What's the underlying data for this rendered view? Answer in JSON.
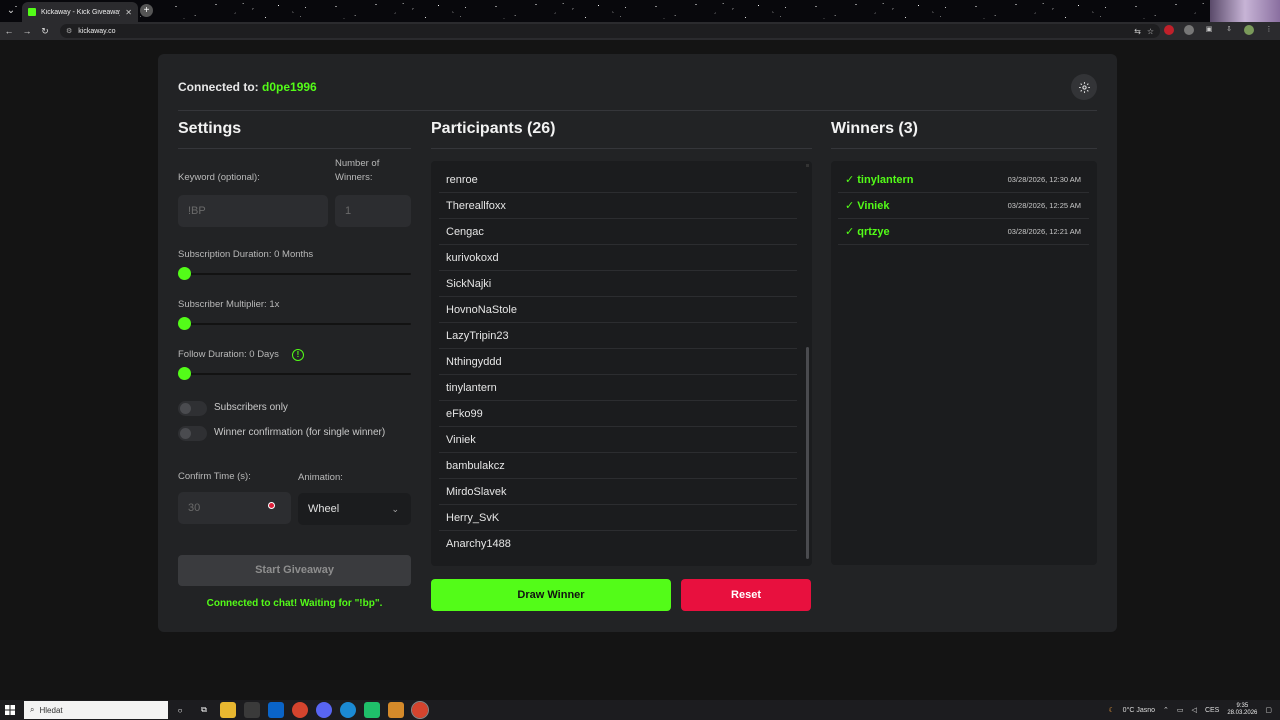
{
  "browser": {
    "tab_title": "Kickaway - Kick Giveaway Tool",
    "url": "kickaway.co"
  },
  "header": {
    "connected_label": "Connected to:",
    "username": "d0pe1996"
  },
  "settings": {
    "title": "Settings",
    "keyword_label": "Keyword (optional):",
    "keyword_value": "!BP",
    "winners_label_1": "Number of",
    "winners_label_2": "Winners:",
    "winners_value": "1",
    "sub_duration_label": "Subscription Duration: 0 Months",
    "sub_duration_value": 0,
    "sub_multiplier_label": "Subscriber Multiplier: 1x",
    "sub_multiplier_value": 1,
    "follow_duration_label": "Follow Duration:  0  Days",
    "follow_duration_value": 0,
    "subscribers_only_label": "Subscribers only",
    "subscribers_only": false,
    "winner_confirm_label": "Winner confirmation (for single winner)",
    "winner_confirm": false,
    "confirm_time_label": "Confirm Time (s):",
    "confirm_time_value": "30",
    "animation_label": "Animation:",
    "animation_value": "Wheel",
    "start_label": "Start Giveaway",
    "status_text": "Connected to chat! Waiting for \"!bp\"."
  },
  "participants": {
    "title": "Participants (26)",
    "items": [
      "renroe",
      "Thereallfoxx",
      "Cengac",
      "kurivokoxd",
      "SickNajki",
      "HovnoNaStole",
      "LazyTripin23",
      "Nthingyddd",
      "tinylantern",
      "eFko99",
      "Viniek",
      "bambulakcz",
      "MirdoSlavek",
      "Herry_SvK",
      "Anarchy1488"
    ],
    "draw_label": "Draw Winner",
    "reset_label": "Reset"
  },
  "winners": {
    "title": "Winners (3)",
    "items": [
      {
        "name": "✓ tinylantern",
        "time": "03/28/2026, 12:30 AM"
      },
      {
        "name": "✓ Viniek",
        "time": "03/28/2026, 12:25 AM"
      },
      {
        "name": "✓ qrtzye",
        "time": "03/28/2026, 12:21 AM"
      }
    ]
  },
  "taskbar": {
    "search_placeholder": "Hledat",
    "weather": "0°C  Jasno",
    "lang": "CES",
    "time": "9:35",
    "date": "28.03.2026"
  },
  "colors": {
    "accent": "#53fc18",
    "danger": "#e8103e",
    "card": "#222325",
    "panel": "#1b1c1e"
  }
}
